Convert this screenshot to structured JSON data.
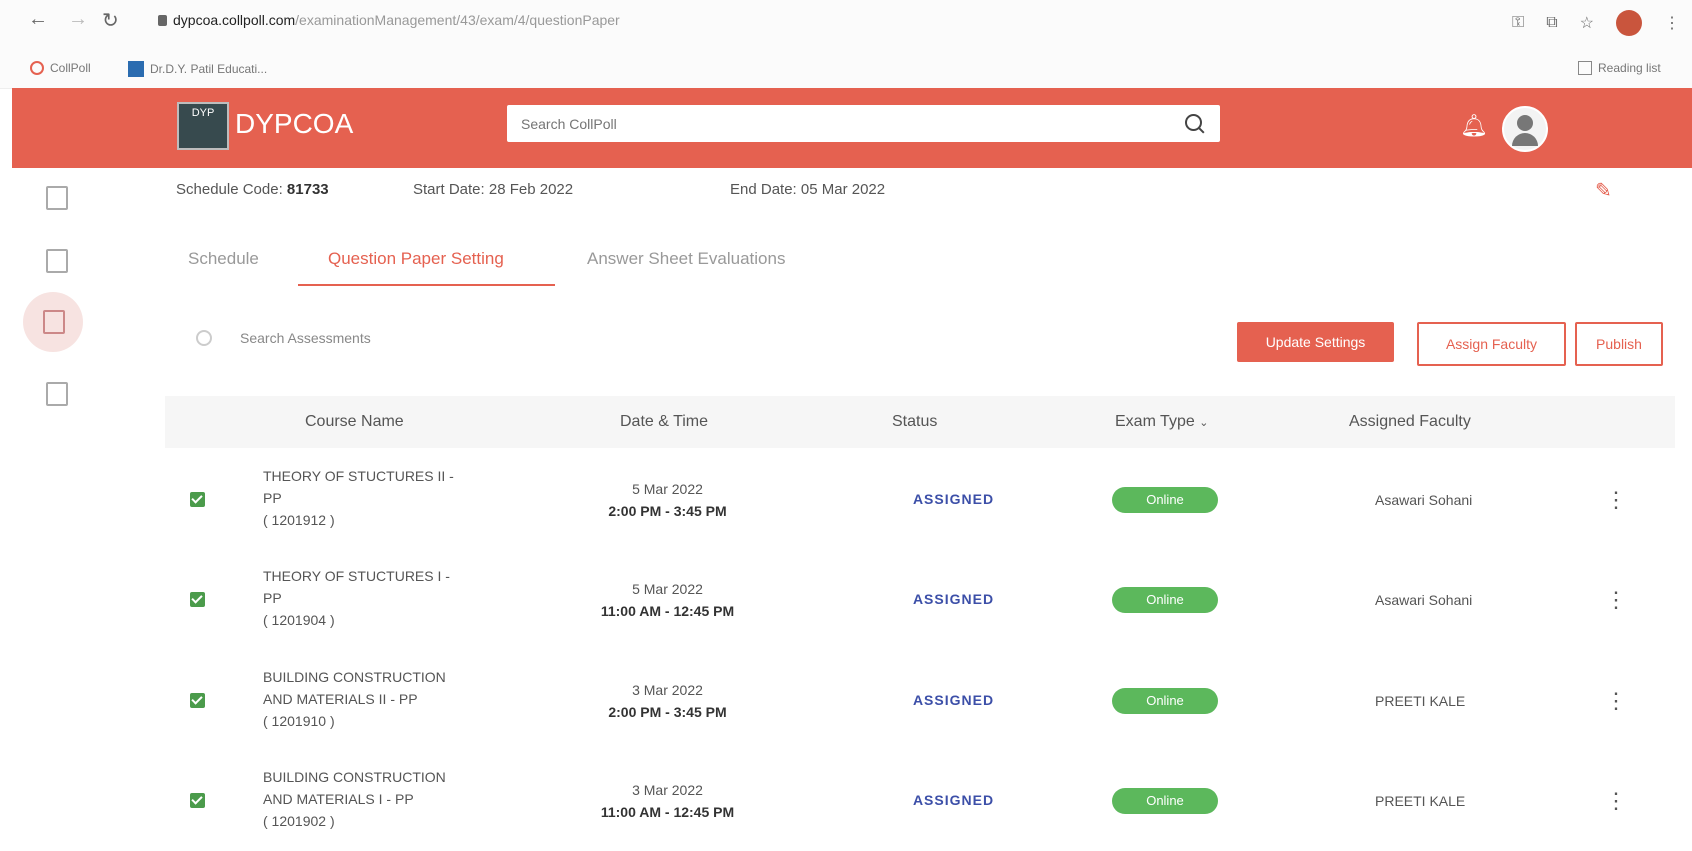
{
  "browser": {
    "url_host": "dypcoa.collpoll.com",
    "url_path": "/examinationManagement/43/exam/4/questionPaper",
    "bookmarks": [
      "CollPoll",
      "Dr.D.Y. Patil Educati..."
    ],
    "reading_list": "Reading list"
  },
  "header": {
    "logo_badge": "DYP",
    "app_name": "DYPCOA",
    "search_placeholder": "Search CollPoll"
  },
  "schedule_info": {
    "code_label": "Schedule Code:",
    "code_value": "81733",
    "start_label": "Start Date:",
    "start_value": "28 Feb 2022",
    "end_label": "End Date:",
    "end_value": "05 Mar 2022"
  },
  "tabs": [
    {
      "label": "Schedule"
    },
    {
      "label": "Question Paper Setting",
      "active": true
    },
    {
      "label": "Answer Sheet Evaluations"
    }
  ],
  "toolbar": {
    "search_placeholder": "Search Assessments",
    "update_label": "Update Settings",
    "assign_label": "Assign Faculty",
    "publish_label": "Publish"
  },
  "table": {
    "headers": [
      "Course Name",
      "Date & Time",
      "Status",
      "Exam Type",
      "Assigned Faculty"
    ],
    "rows": [
      {
        "course_line1": "THEORY OF STUCTURES II -",
        "course_line2": "PP",
        "code": "( 1201912 )",
        "date": "5 Mar 2022",
        "time": "2:00 PM - 3:45 PM",
        "status": "ASSIGNED",
        "exam_type": "Online",
        "faculty": "Asawari Sohani"
      },
      {
        "course_line1": "THEORY OF STUCTURES I -",
        "course_line2": "PP",
        "code": "( 1201904 )",
        "date": "5 Mar 2022",
        "time": "11:00 AM - 12:45 PM",
        "status": "ASSIGNED",
        "exam_type": "Online",
        "faculty": "Asawari Sohani"
      },
      {
        "course_line1": "BUILDING CONSTRUCTION",
        "course_line2": "AND MATERIALS II - PP",
        "code": "( 1201910 )",
        "date": "3 Mar 2022",
        "time": "2:00 PM - 3:45 PM",
        "status": "ASSIGNED",
        "exam_type": "Online",
        "faculty": "PREETI KALE"
      },
      {
        "course_line1": "BUILDING CONSTRUCTION",
        "course_line2": "AND MATERIALS I - PP",
        "code": "( 1201902 )",
        "date": "3 Mar 2022",
        "time": "11:00 AM - 12:45 PM",
        "status": "ASSIGNED",
        "exam_type": "Online",
        "faculty": "PREETI KALE"
      }
    ]
  },
  "colors": {
    "brand": "#e56150",
    "status": "#3c4fa8",
    "online": "#5cb85c"
  }
}
